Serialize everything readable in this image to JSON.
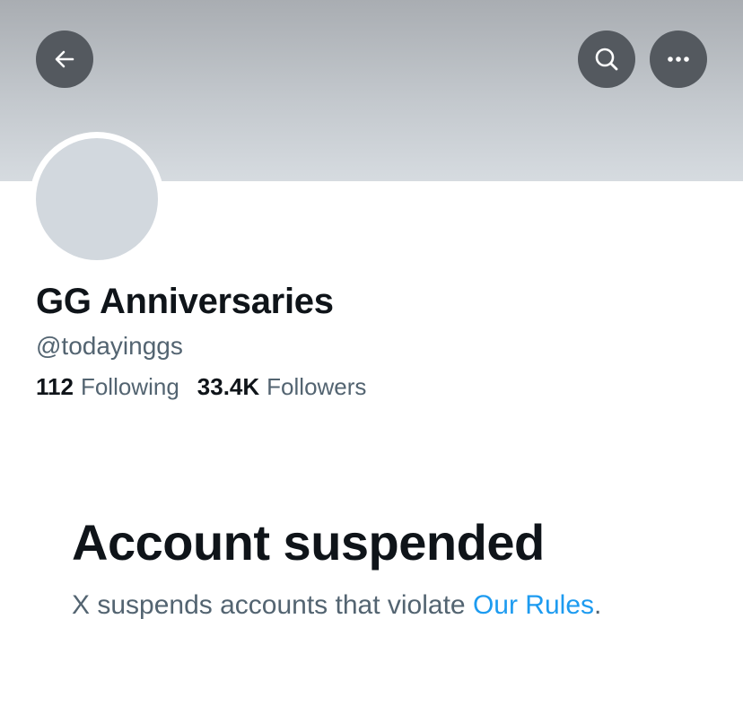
{
  "header": {
    "back_icon": "arrow-left-icon",
    "search_icon": "search-icon",
    "more_icon": "more-horizontal-icon"
  },
  "profile": {
    "display_name": "GG Anniversaries",
    "handle": "@todayinggs",
    "following_count": "112",
    "following_label": "Following",
    "followers_count": "33.4K",
    "followers_label": "Followers"
  },
  "notice": {
    "title": "Account suspended",
    "text": "X suspends accounts that violate ",
    "link_text": "Our Rules",
    "trailing": "."
  },
  "colors": {
    "text_primary": "#0f1419",
    "text_secondary": "#536471",
    "link": "#1d9bf0",
    "button_bg": "#54595f",
    "avatar_placeholder": "#d2d8de"
  }
}
